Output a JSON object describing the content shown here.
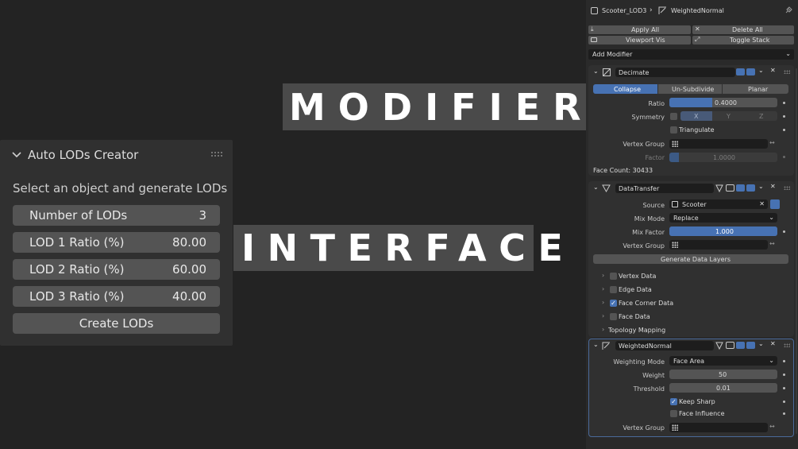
{
  "banners": {
    "top": "MODIFIERS",
    "bottom": "INTERFACE"
  },
  "lod_panel": {
    "title": "Auto LODs Creator",
    "description": "Select an object and generate LODs",
    "fields": [
      {
        "label": "Number of LODs",
        "value": "3"
      },
      {
        "label": "LOD 1 Ratio (%)",
        "value": "80.00"
      },
      {
        "label": "LOD 2 Ratio (%)",
        "value": "60.00"
      },
      {
        "label": "LOD 3 Ratio (%)",
        "value": "40.00"
      }
    ],
    "create_button": "Create LODs"
  },
  "properties": {
    "breadcrumb": {
      "object": "Scooter_LOD3",
      "modifier": "WeightedNormal"
    },
    "toolbar": {
      "apply_all": "Apply All",
      "delete_all": "Delete All",
      "viewport_vis": "Viewport Vis",
      "toggle_stack": "Toggle Stack"
    },
    "add_modifier": "Add Modifier",
    "decimate": {
      "name": "Decimate",
      "tabs": [
        "Collapse",
        "Un-Subdivide",
        "Planar"
      ],
      "active_tab": "Collapse",
      "ratio_label": "Ratio",
      "ratio_value": "0.4000",
      "ratio_fraction": 0.4,
      "symmetry_label": "Symmetry",
      "symmetry_axes": [
        "X",
        "Y",
        "Z"
      ],
      "triangulate": "Triangulate",
      "vertex_group_label": "Vertex Group",
      "factor_label": "Factor",
      "factor_value": "1.0000",
      "face_count": "Face Count: 30433"
    },
    "datatransfer": {
      "name": "DataTransfer",
      "source_label": "Source",
      "source_value": "Scooter",
      "mix_mode_label": "Mix Mode",
      "mix_mode_value": "Replace",
      "mix_factor_label": "Mix Factor",
      "mix_factor_value": "1.000",
      "mix_factor_fraction": 1.0,
      "vertex_group_label": "Vertex Group",
      "generate_button": "Generate Data Layers",
      "sections": [
        {
          "label": "Vertex Data",
          "checked": false
        },
        {
          "label": "Edge Data",
          "checked": false
        },
        {
          "label": "Face Corner Data",
          "checked": true
        },
        {
          "label": "Face Data",
          "checked": false
        }
      ],
      "topology": "Topology Mapping"
    },
    "weightednormal": {
      "name": "WeightedNormal",
      "weighting_mode_label": "Weighting Mode",
      "weighting_mode_value": "Face Area",
      "weight_label": "Weight",
      "weight_value": "50",
      "threshold_label": "Threshold",
      "threshold_value": "0.01",
      "keep_sharp": "Keep Sharp",
      "keep_sharp_checked": true,
      "face_influence": "Face Influence",
      "face_influence_checked": false,
      "vertex_group_label": "Vertex Group"
    },
    "colors": {
      "accent": "#4772b3",
      "panel": "#303030",
      "field": "#1d1d1d"
    }
  }
}
